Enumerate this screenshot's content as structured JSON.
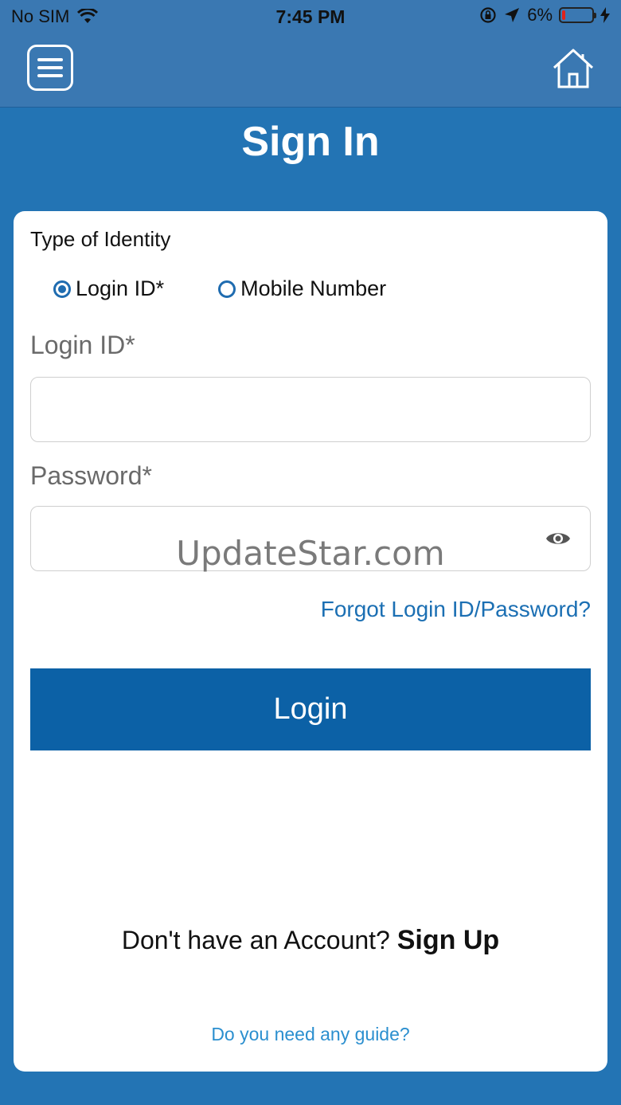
{
  "status_bar": {
    "carrier": "No SIM",
    "time": "7:45 PM",
    "battery": "6%"
  },
  "nav": {
    "menu_icon": "hamburger-menu-icon",
    "home_icon": "home-icon"
  },
  "page": {
    "title": "Sign In"
  },
  "form": {
    "type_label": "Type of Identity",
    "options": [
      {
        "label": "Login ID*",
        "selected": true
      },
      {
        "label": "Mobile Number",
        "selected": false
      }
    ],
    "login_id_label": "Login ID*",
    "login_id_value": "",
    "password_label": "Password*",
    "password_value": "",
    "forgot_link": "Forgot Login ID/Password?",
    "login_button": "Login"
  },
  "footer": {
    "signup_prompt": "Don't have an Account?",
    "signup_link": "Sign Up",
    "guide_link": "Do you need any guide?"
  },
  "watermark": "UpdateStar.com",
  "colors": {
    "primary": "#0c61a6",
    "background": "#2374b4",
    "link": "#1b6fb3"
  }
}
